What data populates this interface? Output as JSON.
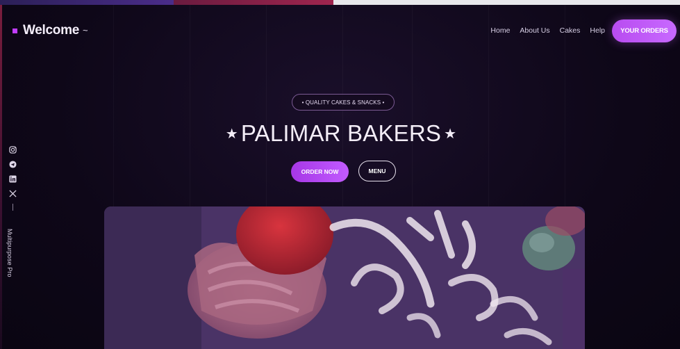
{
  "brand": {
    "title": "Welcome",
    "caret": "~"
  },
  "nav": {
    "links": [
      "Home",
      "About Us",
      "Cakes",
      "Help"
    ],
    "cta": "YOUR ORDERS"
  },
  "hero": {
    "tagline": "• QUALITY CAKES & SNACKS •",
    "title": "PALIMAR BAKERS",
    "star": "★",
    "primary_button": "ORDER NOW",
    "secondary_button": "MENU"
  },
  "sidebar": {
    "social_icons": [
      "instagram-icon",
      "telegram-icon",
      "linkedin-icon",
      "x-icon"
    ],
    "vertical_text": "Multipurpose Pro"
  },
  "colors": {
    "background": "#0c0614",
    "accent": "#c25bff",
    "hero_overlay": "#4b3368"
  }
}
